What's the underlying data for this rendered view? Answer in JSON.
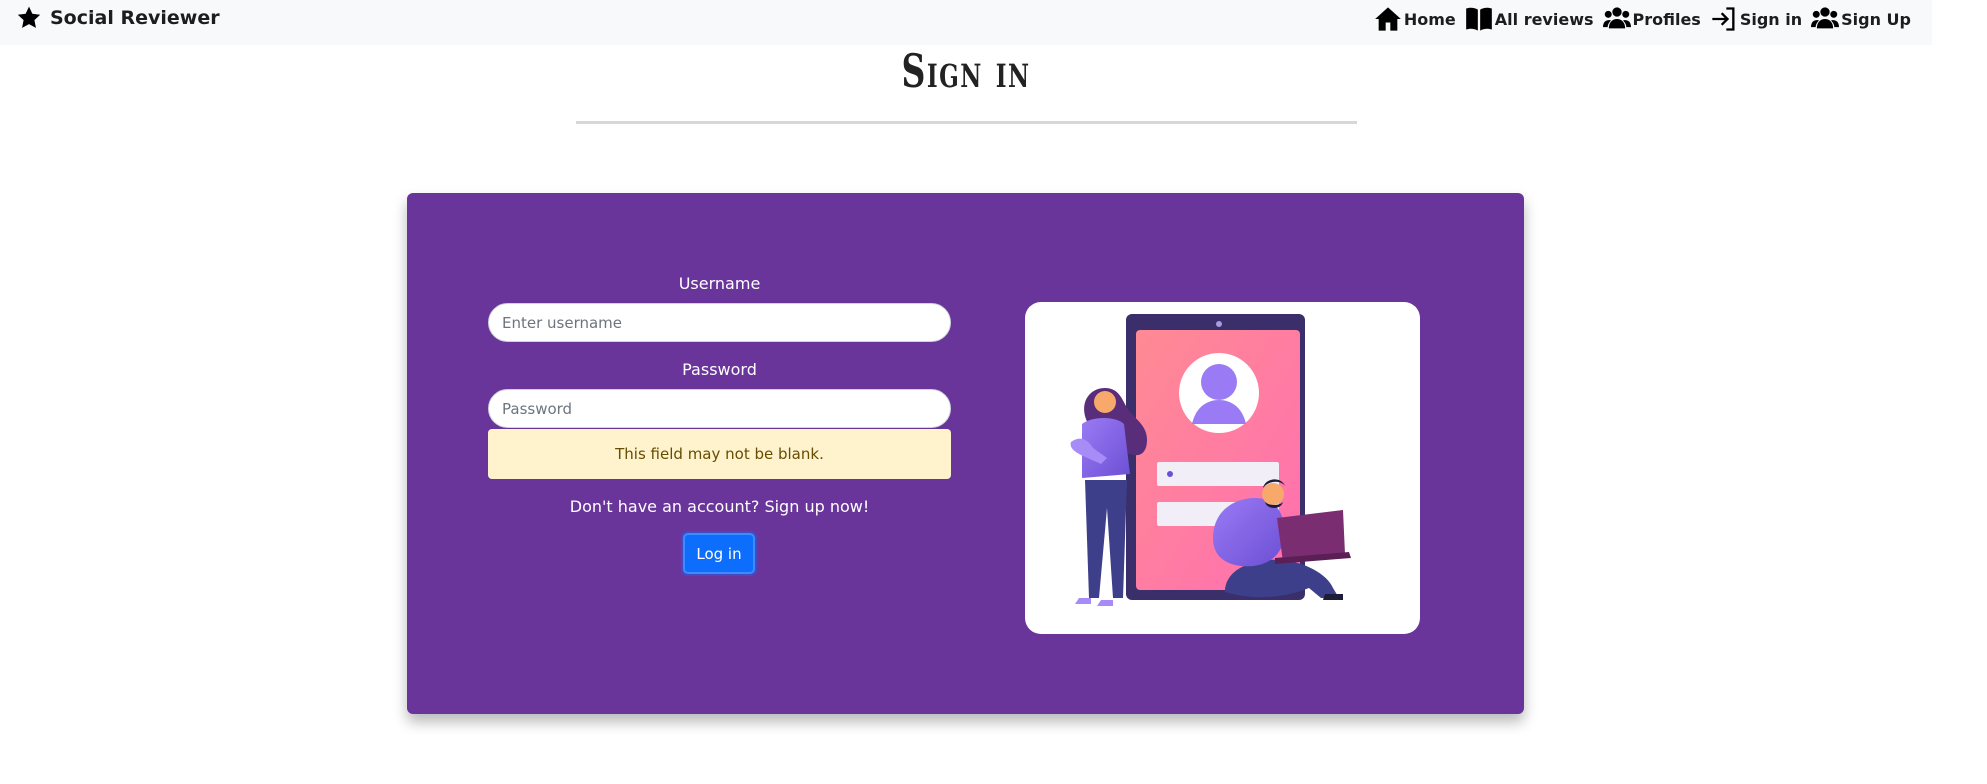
{
  "navbar": {
    "brand": "Social Reviewer",
    "links": [
      {
        "label": "Home",
        "icon": "home-icon"
      },
      {
        "label": "All reviews",
        "icon": "book-icon"
      },
      {
        "label": "Profiles",
        "icon": "users-icon"
      },
      {
        "label": "Sign in",
        "icon": "sign-in-icon"
      },
      {
        "label": "Sign Up",
        "icon": "user-group-icon"
      }
    ]
  },
  "page": {
    "title": "Sign in"
  },
  "form": {
    "username_label": "Username",
    "username_placeholder": "Enter username",
    "username_value": "",
    "password_label": "Password",
    "password_placeholder": "Password",
    "password_value": "",
    "error_message": "This field may not be blank.",
    "signup_prompt": "Don't have an account? Sign up now!",
    "login_button": "Log in"
  },
  "colors": {
    "panel": "#6a359b",
    "navbar": "#f8f9fa",
    "button": "#0d6efd",
    "alert_bg": "#fff3cd",
    "alert_text": "#664d03"
  }
}
